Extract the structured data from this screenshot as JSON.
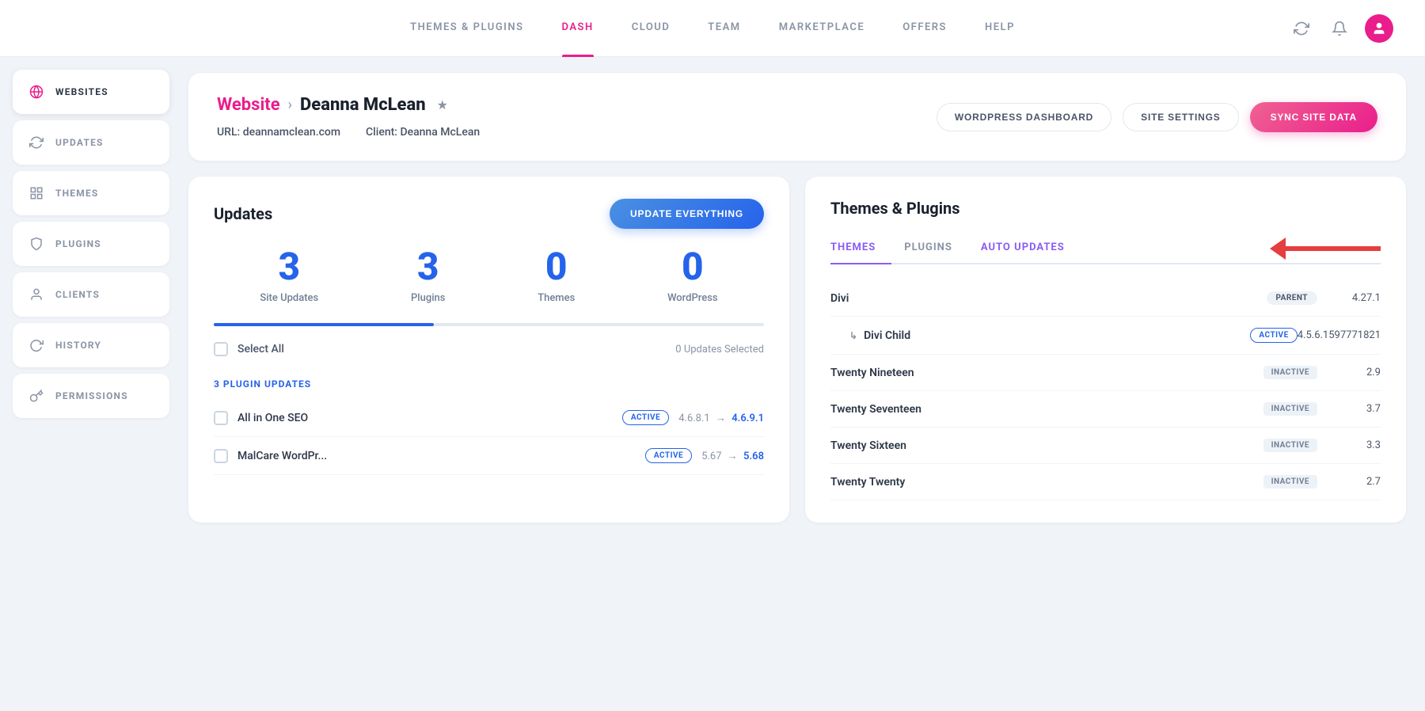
{
  "nav": {
    "links": [
      {
        "id": "themes-plugins",
        "label": "THEMES & PLUGINS",
        "active": false
      },
      {
        "id": "dash",
        "label": "DASH",
        "active": true
      },
      {
        "id": "cloud",
        "label": "CLOUD",
        "active": false
      },
      {
        "id": "team",
        "label": "TEAM",
        "active": false
      },
      {
        "id": "marketplace",
        "label": "MARKETPLACE",
        "active": false
      },
      {
        "id": "offers",
        "label": "OFFERS",
        "active": false
      },
      {
        "id": "help",
        "label": "HELP",
        "active": false
      }
    ]
  },
  "sidebar": {
    "items": [
      {
        "id": "websites",
        "label": "WEBSITES",
        "active": true,
        "icon": "globe"
      },
      {
        "id": "updates",
        "label": "UPDATES",
        "active": false,
        "icon": "refresh"
      },
      {
        "id": "themes",
        "label": "THEMES",
        "active": false,
        "icon": "layout"
      },
      {
        "id": "plugins",
        "label": "PLUGINS",
        "active": false,
        "icon": "shield"
      },
      {
        "id": "clients",
        "label": "CLIENTS",
        "active": false,
        "icon": "user"
      },
      {
        "id": "history",
        "label": "HISTORY",
        "active": false,
        "icon": "clock"
      },
      {
        "id": "permissions",
        "label": "PERMISSIONS",
        "active": false,
        "icon": "key"
      }
    ]
  },
  "header": {
    "breadcrumb_website": "Website",
    "breadcrumb_sep": "›",
    "breadcrumb_current": "Deanna McLean",
    "url_label": "URL:",
    "url_value": "deannamclean.com",
    "client_label": "Client:",
    "client_value": "Deanna McLean",
    "btn_wp_dashboard": "WORDPRESS DASHBOARD",
    "btn_site_settings": "SITE SETTINGS",
    "btn_sync": "SYNC SITE DATA"
  },
  "updates": {
    "panel_title": "Updates",
    "btn_update": "UPDATE EVERYTHING",
    "stats": [
      {
        "number": "3",
        "label": "Site Updates"
      },
      {
        "number": "3",
        "label": "Plugins"
      },
      {
        "number": "0",
        "label": "Themes"
      },
      {
        "number": "0",
        "label": "WordPress"
      }
    ],
    "select_all_label": "Select All",
    "updates_count": "0 Updates Selected",
    "section_label": "3 PLUGIN UPDATES",
    "plugins": [
      {
        "name": "All in One SEO",
        "badge": "ACTIVE",
        "version_from": "4.6.8.1",
        "arrow": "→",
        "version_to": "4.6.9.1"
      },
      {
        "name": "MalCare WordPr...",
        "badge": "ACTIVE",
        "version_from": "5.67",
        "arrow": "→",
        "version_to": "5.68"
      }
    ]
  },
  "themes_plugins": {
    "panel_title": "Themes & Plugins",
    "tabs": [
      {
        "id": "themes",
        "label": "THEMES",
        "active": true
      },
      {
        "id": "plugins",
        "label": "PLUGINS",
        "active": false
      },
      {
        "id": "auto-updates",
        "label": "AUTO UPDATES",
        "active": false
      }
    ],
    "themes": [
      {
        "name": "Divi",
        "badge_type": "parent",
        "badge_label": "PARENT",
        "version": "4.27.1",
        "indent": false
      },
      {
        "name": "Divi Child",
        "badge_type": "active",
        "badge_label": "ACTIVE",
        "version": "4.5.6.1597771821",
        "indent": true
      },
      {
        "name": "Twenty Nineteen",
        "badge_type": "inactive",
        "badge_label": "INACTIVE",
        "version": "2.9",
        "indent": false
      },
      {
        "name": "Twenty Seventeen",
        "badge_type": "inactive",
        "badge_label": "INACTIVE",
        "version": "3.7",
        "indent": false
      },
      {
        "name": "Twenty Sixteen",
        "badge_type": "inactive",
        "badge_label": "INACTIVE",
        "version": "3.3",
        "indent": false
      },
      {
        "name": "Twenty Twenty",
        "badge_type": "inactive",
        "badge_label": "INACTIVE",
        "version": "2.7",
        "indent": false
      }
    ]
  },
  "colors": {
    "pink": "#e91e8c",
    "blue": "#2563eb",
    "purple": "#8b5cf6",
    "red": "#e53e3e"
  }
}
